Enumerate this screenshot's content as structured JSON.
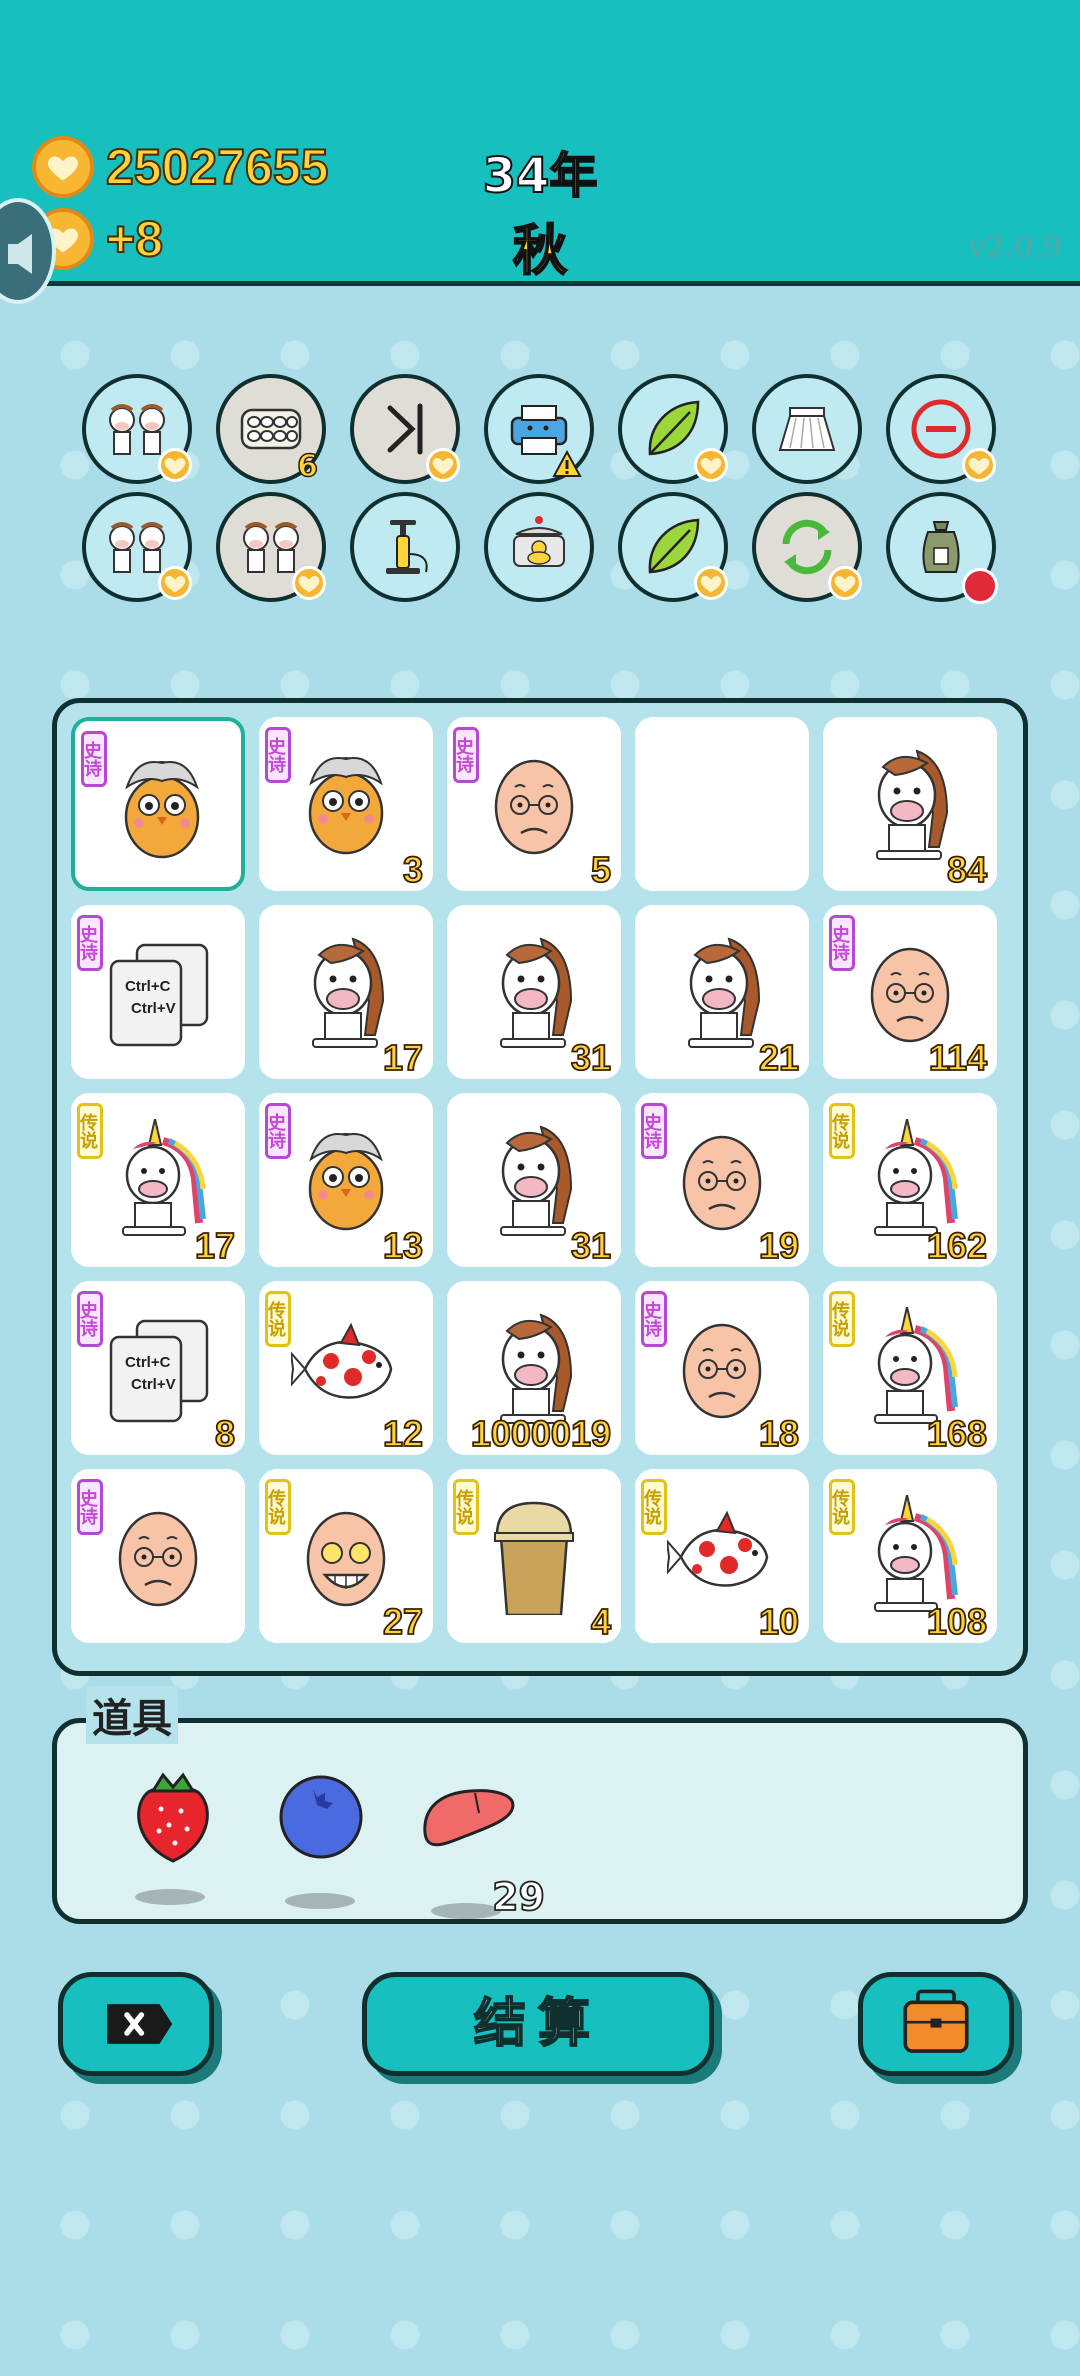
{
  "header": {
    "money": "25027655",
    "income": "+8",
    "year": "34年",
    "season": "秋",
    "version": "v2.0.9"
  },
  "skills_row1": [
    {
      "icon": "two-cows-icon",
      "count": ""
    },
    {
      "icon": "egg-tray-icon",
      "count": "6"
    },
    {
      "icon": "skip-forward-icon",
      "count": ""
    },
    {
      "icon": "printer-icon",
      "count": ""
    },
    {
      "icon": "green-leaf-icon",
      "count": ""
    },
    {
      "icon": "skirt-icon",
      "count": ""
    },
    {
      "icon": "no-entry-icon",
      "count": ""
    }
  ],
  "skills_row2": [
    {
      "icon": "two-cows-icon"
    },
    {
      "icon": "two-cows-icon"
    },
    {
      "icon": "air-pump-icon"
    },
    {
      "icon": "pot-with-duck-icon"
    },
    {
      "icon": "green-leaf-icon"
    },
    {
      "icon": "refresh-arrows-icon"
    },
    {
      "icon": "sack-icon"
    }
  ],
  "board": [
    [
      {
        "art": "chick-grandpa",
        "tag": "史诗",
        "num": ""
      },
      {
        "art": "chick-grandpa",
        "tag": "史诗",
        "num": "3"
      },
      {
        "art": "old-man",
        "tag": "史诗",
        "num": "5"
      },
      {
        "art": "",
        "tag": "",
        "num": ""
      },
      {
        "art": "horse",
        "tag": "",
        "num": "84"
      }
    ],
    [
      {
        "art": "copy-paste",
        "tag": "史诗",
        "num": ""
      },
      {
        "art": "horse",
        "tag": "",
        "num": "17"
      },
      {
        "art": "horse",
        "tag": "",
        "num": "31"
      },
      {
        "art": "horse",
        "tag": "",
        "num": "21"
      },
      {
        "art": "old-man",
        "tag": "史诗",
        "num": "114"
      }
    ],
    [
      {
        "art": "unicorn",
        "tag": "传说",
        "num": "17"
      },
      {
        "art": "chick-grandpa",
        "tag": "史诗",
        "num": "13"
      },
      {
        "art": "horse",
        "tag": "",
        "num": "31"
      },
      {
        "art": "old-man",
        "tag": "史诗",
        "num": "19"
      },
      {
        "art": "unicorn",
        "tag": "传说",
        "num": "162"
      }
    ],
    [
      {
        "art": "copy-paste",
        "tag": "史诗",
        "num": "8"
      },
      {
        "art": "koi-fish",
        "tag": "传说",
        "num": "12"
      },
      {
        "art": "horse",
        "tag": "",
        "num": "1000019"
      },
      {
        "art": "old-man",
        "tag": "史诗",
        "num": "18"
      },
      {
        "art": "unicorn",
        "tag": "传说",
        "num": "168"
      }
    ],
    [
      {
        "art": "old-man",
        "tag": "史诗",
        "num": ""
      },
      {
        "art": "happy-old-man",
        "tag": "传说",
        "num": "27"
      },
      {
        "art": "milk-tea",
        "tag": "传说",
        "num": "4"
      },
      {
        "art": "koi-fish",
        "tag": "传说",
        "num": "10"
      },
      {
        "art": "unicorn",
        "tag": "传说",
        "num": "108"
      }
    ]
  ],
  "tools": {
    "title": "道具",
    "items": [
      {
        "icon": "strawberry-icon",
        "qty": ""
      },
      {
        "icon": "blueberry-icon",
        "qty": ""
      },
      {
        "icon": "liver-icon",
        "qty": "29"
      }
    ]
  },
  "buttons": {
    "settle": "结算"
  },
  "colors": {
    "header": "#17bfbf",
    "background": "#abdde8",
    "number": "#ffd43a",
    "epic_tag": "#c44ad4",
    "legend_tag": "#e0c21a"
  }
}
